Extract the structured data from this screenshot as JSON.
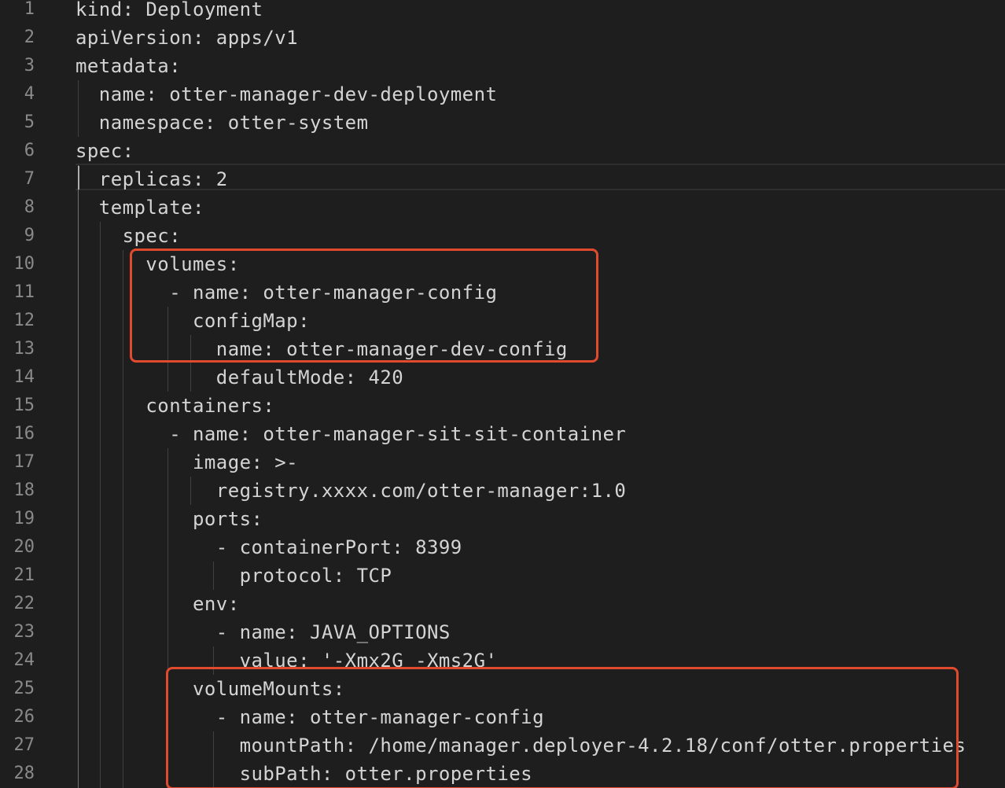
{
  "editor": {
    "theme_colors": {
      "background": "#1e1e1e",
      "text": "#d4d4d4",
      "line_number": "#8a8a8a",
      "highlight_box": "#e04a2f"
    },
    "lines": [
      {
        "num": "1",
        "text": "kind: Deployment"
      },
      {
        "num": "2",
        "text": "apiVersion: apps/v1"
      },
      {
        "num": "3",
        "text": "metadata:"
      },
      {
        "num": "4",
        "text": "  name: otter-manager-dev-deployment"
      },
      {
        "num": "5",
        "text": "  namespace: otter-system"
      },
      {
        "num": "6",
        "text": "spec:"
      },
      {
        "num": "7",
        "text": "  replicas: 2"
      },
      {
        "num": "8",
        "text": "  template:"
      },
      {
        "num": "9",
        "text": "    spec:"
      },
      {
        "num": "10",
        "text": "      volumes:"
      },
      {
        "num": "11",
        "text": "        - name: otter-manager-config"
      },
      {
        "num": "12",
        "text": "          configMap:"
      },
      {
        "num": "13",
        "text": "            name: otter-manager-dev-config"
      },
      {
        "num": "14",
        "text": "            defaultMode: 420"
      },
      {
        "num": "15",
        "text": "      containers:"
      },
      {
        "num": "16",
        "text": "        - name: otter-manager-sit-sit-container"
      },
      {
        "num": "17",
        "text": "          image: >-"
      },
      {
        "num": "18",
        "text": "            registry.xxxx.com/otter-manager:1.0"
      },
      {
        "num": "19",
        "text": "          ports:"
      },
      {
        "num": "20",
        "text": "            - containerPort: 8399"
      },
      {
        "num": "21",
        "text": "              protocol: TCP"
      },
      {
        "num": "22",
        "text": "          env:"
      },
      {
        "num": "23",
        "text": "            - name: JAVA_OPTIONS"
      },
      {
        "num": "24",
        "text": "              value: '-Xmx2G -Xms2G'"
      },
      {
        "num": "25",
        "text": "          volumeMounts:"
      },
      {
        "num": "26",
        "text": "            - name: otter-manager-config"
      },
      {
        "num": "27",
        "text": "              mountPath: /home/manager.deployer-4.2.18/conf/otter.properties"
      },
      {
        "num": "28",
        "text": "              subPath: otter.properties"
      }
    ]
  }
}
